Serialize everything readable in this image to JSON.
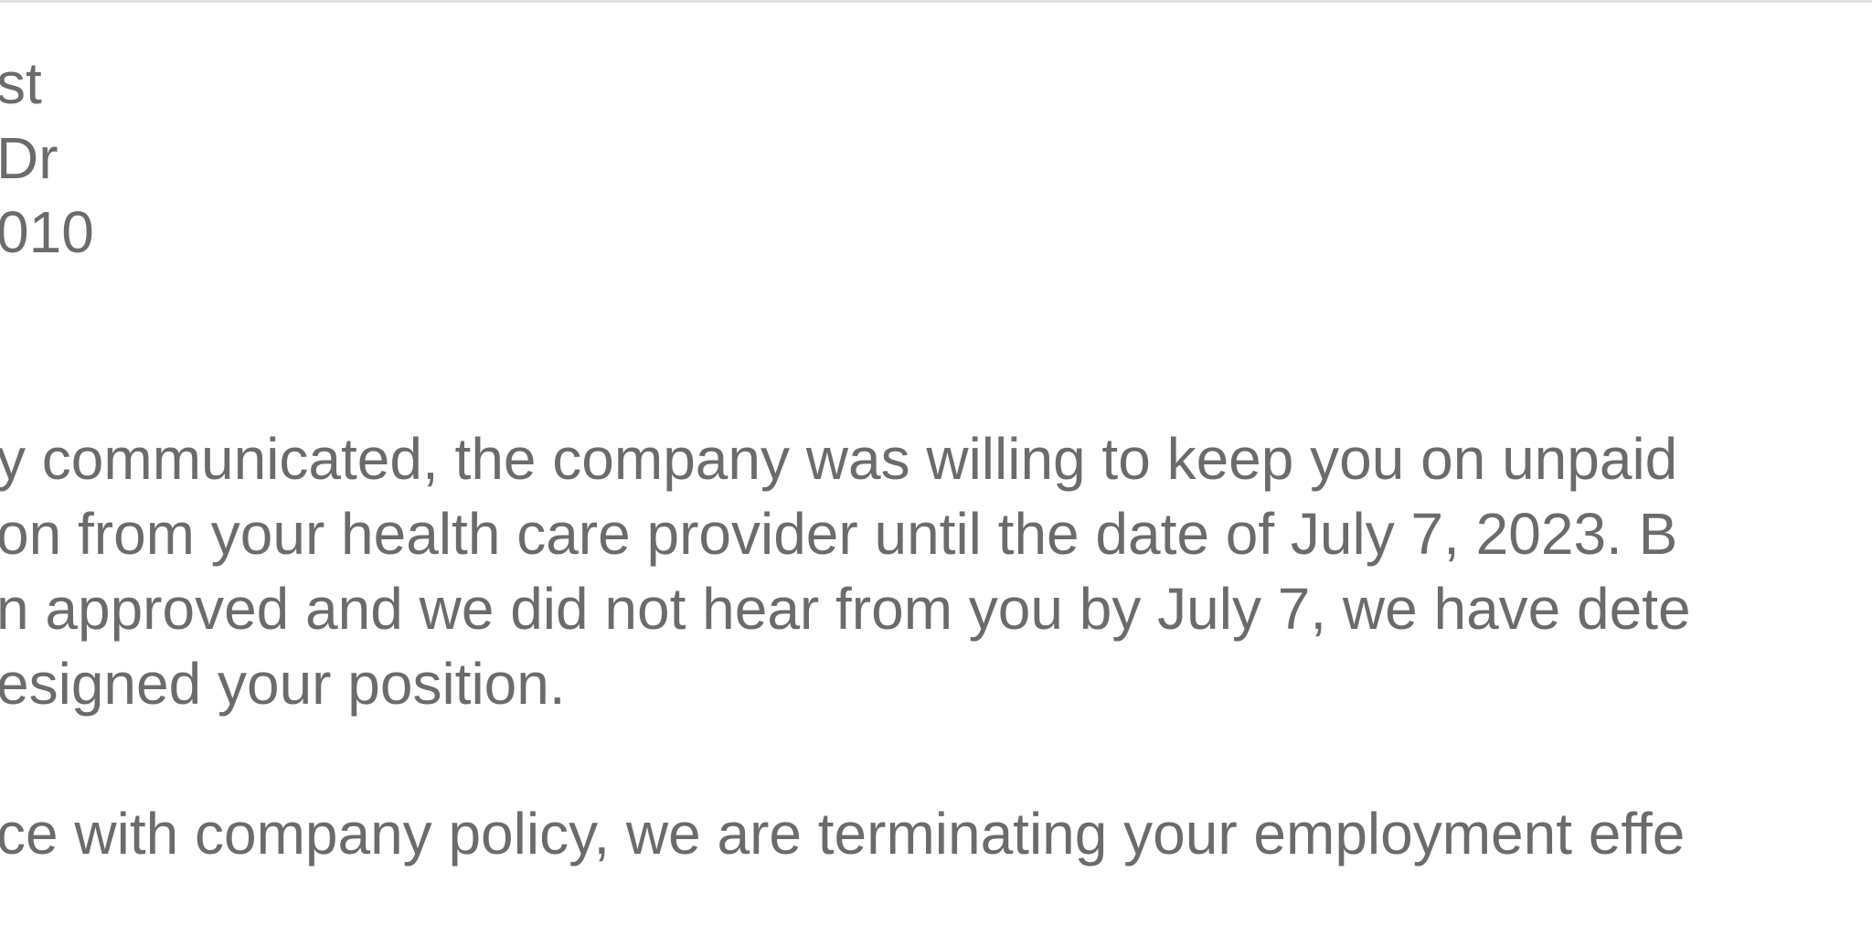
{
  "address": {
    "line1": "st",
    "line2": " Dr",
    "line3": "010"
  },
  "paragraph1": {
    "line1": "y communicated, the company was willing to keep you on unpaid",
    "line2": "on from your health care provider until the date of July 7, 2023. B",
    "line3": "n approved and we did not hear from you by July 7, we have dete",
    "line4": "esigned your position."
  },
  "paragraph2": {
    "line1": "ce with company policy, we are terminating your employment effe"
  }
}
